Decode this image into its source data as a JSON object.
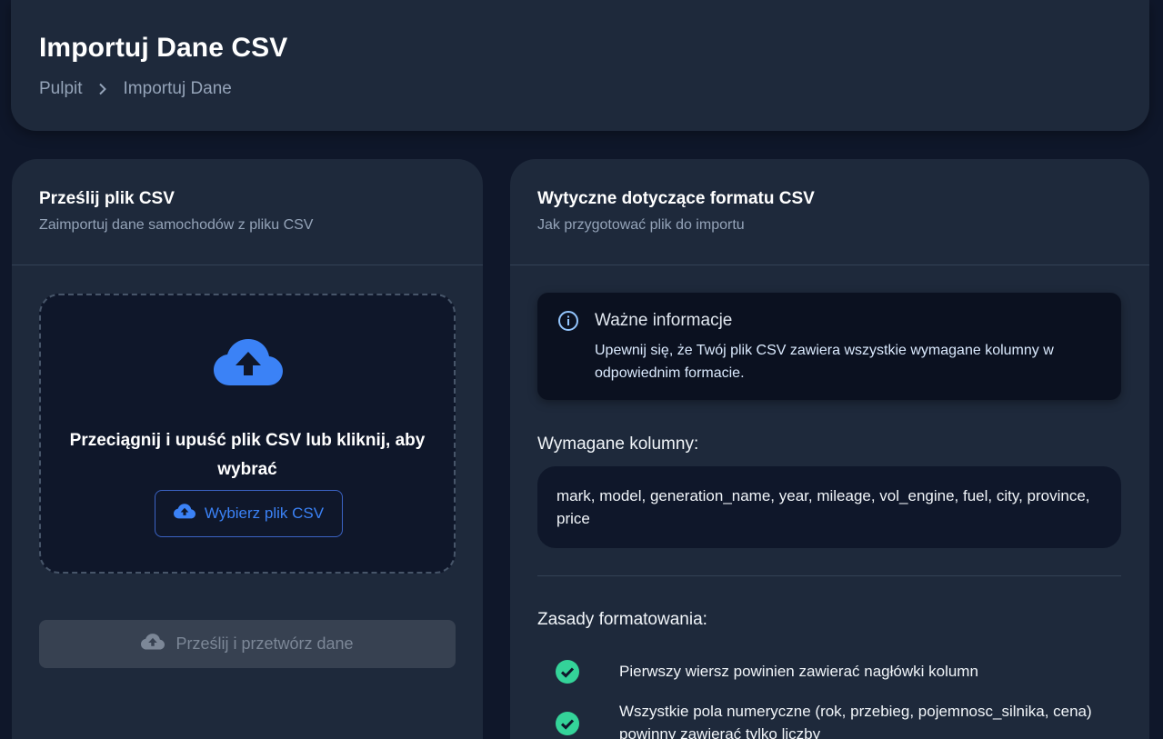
{
  "header": {
    "title": "Importuj Dane CSV",
    "breadcrumb": [
      "Pulpit",
      "Importuj Dane"
    ]
  },
  "upload_card": {
    "title": "Prześlij plik CSV",
    "subtitle": "Zaimportuj dane samochodów z pliku CSV",
    "dropzone_text": "Przeciągnij i upuść plik CSV lub kliknij, aby wybrać",
    "choose_button": "Wybierz plik CSV",
    "submit_button": "Prześlij i przetwórz dane"
  },
  "guidelines_card": {
    "title": "Wytyczne dotyczące formatu CSV",
    "subtitle": "Jak przygotować plik do importu",
    "info": {
      "title": "Ważne informacje",
      "text": "Upewnij się, że Twój plik CSV zawiera wszystkie wymagane kolumny w odpowiednim formacie."
    },
    "required_columns_label": "Wymagane kolumny:",
    "required_columns": "mark, model, generation_name, year, mileage, vol_engine, fuel, city, province, price",
    "rules_label": "Zasady formatowania:",
    "rules": [
      "Pierwszy wiersz powinien zawierać nagłówki kolumn",
      "Wszystkie pola numeryczne (rok, przebieg, pojemnosc_silnika, cena) powinny zawierać tylko liczby"
    ]
  },
  "colors": {
    "background": "#0f172a",
    "card": "#1e293b",
    "accent": "#3b82f6",
    "success": "#34d399"
  },
  "icons": [
    "chevron-right-icon",
    "cloud-upload-icon",
    "info-icon",
    "check-circle-icon"
  ]
}
